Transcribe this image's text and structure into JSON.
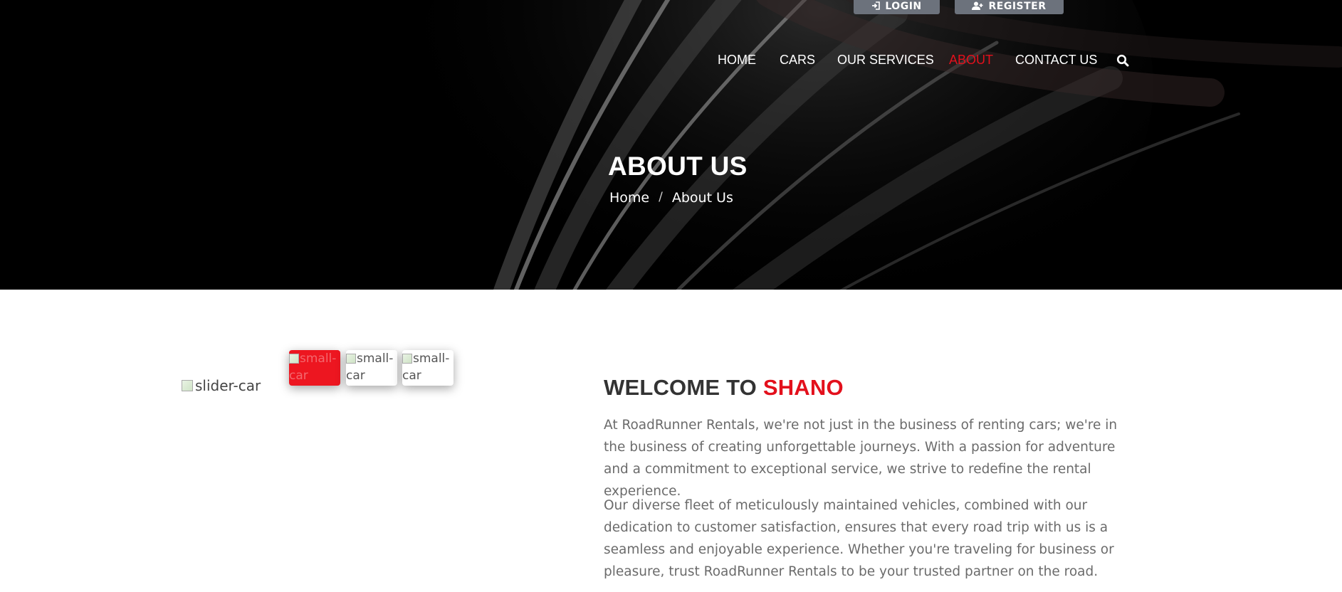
{
  "top_buttons": {
    "login": "LOGIN",
    "register": "REGISTER"
  },
  "nav": {
    "items": [
      {
        "label": "HOME",
        "active": false
      },
      {
        "label": "CARS",
        "active": false
      },
      {
        "label": "OUR SERVICES",
        "active": false
      },
      {
        "label": "ABOUT",
        "active": true
      },
      {
        "label": "CONTACT US",
        "active": false
      }
    ],
    "search_icon": "search-icon"
  },
  "hero": {
    "title": "ABOUT US",
    "breadcrumb": {
      "home": "Home",
      "separator": "/",
      "current": "About Us"
    }
  },
  "slider": {
    "main_alt": "slider-car",
    "thumbs": [
      {
        "alt": "small-car",
        "active": true
      },
      {
        "alt": "small-car",
        "active": false
      },
      {
        "alt": "small-car",
        "active": false
      }
    ]
  },
  "about": {
    "heading_prefix": "WELCOME TO",
    "heading_accent": "SHANO",
    "paragraph1": "At RoadRunner Rentals, we're not just in the business of renting cars; we're in the business of creating unforgettable journeys. With a passion for adventure and a commitment to exceptional service, we strive to redefine the rental experience.",
    "paragraph2": "Our diverse fleet of meticulously maintained vehicles, combined with our dedication to customer satisfaction, ensures that every road trip with us is a seamless and enjoyable experience. Whether you're traveling for business or pleasure, trust RoadRunner Rentals to be your trusted partner on the road."
  },
  "colors": {
    "accent": "#e3101c",
    "button_gray": "#6c727c",
    "hero_bg": "#000000",
    "text_body": "#6b6b6b"
  }
}
